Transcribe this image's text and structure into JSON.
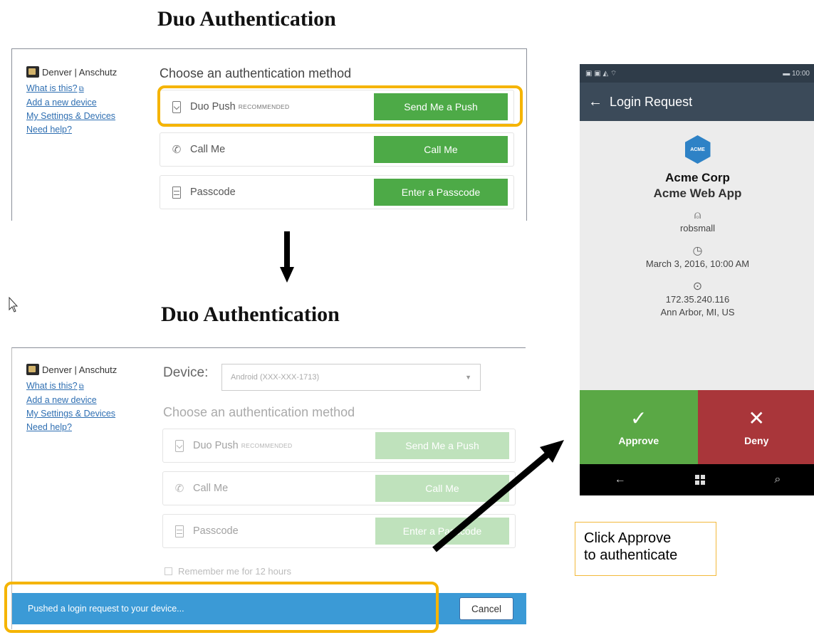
{
  "headings": {
    "top": "Duo Authentication",
    "bottom": "Duo Authentication"
  },
  "org": {
    "name": "Denver | Anschutz"
  },
  "links": [
    {
      "label": "What is this?",
      "external": true
    },
    {
      "label": "Add a new device"
    },
    {
      "label": "My Settings & Devices"
    },
    {
      "label": "Need help?"
    }
  ],
  "prompt": {
    "title": "Choose an authentication method"
  },
  "methods": [
    {
      "label": "Duo Push",
      "tag": "RECOMMENDED",
      "button": "Send Me a Push",
      "icon": "device-check-icon"
    },
    {
      "label": "Call Me",
      "button": "Call Me",
      "icon": "phone-call-icon"
    },
    {
      "label": "Passcode",
      "button": "Enter a Passcode",
      "icon": "passcode-icon"
    }
  ],
  "device": {
    "label": "Device:",
    "selected": "Android (XXX-XXX-1713)"
  },
  "remember": {
    "label": "Remember me for 12 hours"
  },
  "status": {
    "message": "Pushed a login request to your device...",
    "cancel": "Cancel"
  },
  "colors": {
    "green": "#4daa47",
    "highlight": "#f5b400",
    "statusbar": "#3b9ad6",
    "approve": "#5aa845",
    "deny": "#a9363a"
  },
  "phone": {
    "status_time": "10:00",
    "header": "Login Request",
    "logo_text": "ACME",
    "company": "Acme Corp",
    "app": "Acme Web App",
    "user": "robsmall",
    "datetime": "March 3, 2016, 10:00 AM",
    "ip": "172.35.240.116",
    "location": "Ann Arbor, MI, US",
    "approve": "Approve",
    "deny": "Deny"
  },
  "callout": {
    "line1": "Click Approve",
    "line2": "to authenticate"
  }
}
